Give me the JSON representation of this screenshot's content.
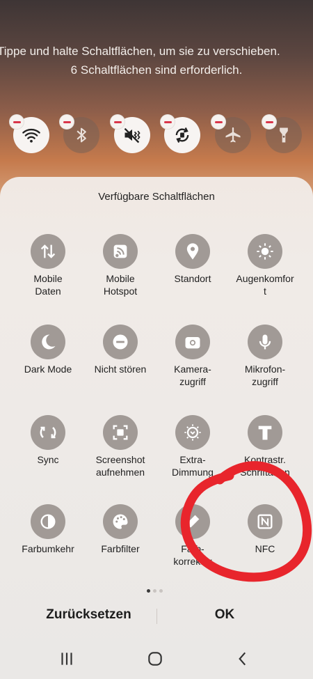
{
  "header": {
    "hint_line1": "Tippe und halte Schaltflächen, um sie zu verschieben.",
    "hint_line2": "6 Schaltflächen sind erforderlich."
  },
  "active_buttons": [
    {
      "name": "wlan",
      "icon": "wifi-icon",
      "state": "on"
    },
    {
      "name": "bluetooth",
      "icon": "bluetooth-icon",
      "state": "off"
    },
    {
      "name": "ton",
      "icon": "sound-vibrate-icon",
      "state": "on"
    },
    {
      "name": "auto-drehen",
      "icon": "auto-rotate-icon",
      "state": "on"
    },
    {
      "name": "flugmodus",
      "icon": "airplane-icon",
      "state": "off"
    },
    {
      "name": "taschenlampe",
      "icon": "flashlight-icon",
      "state": "off"
    }
  ],
  "panel": {
    "title": "Verfügbare Schaltflächen",
    "tiles": [
      {
        "label": "Mobile\nDaten",
        "icon": "mobile-data-icon"
      },
      {
        "label": "Mobile\nHotspot",
        "icon": "hotspot-icon"
      },
      {
        "label": "Standort",
        "icon": "location-icon"
      },
      {
        "label": "Augenkomfor\nt",
        "icon": "eye-comfort-icon"
      },
      {
        "label": "Dark Mode",
        "icon": "dark-mode-icon"
      },
      {
        "label": "Nicht stören",
        "icon": "do-not-disturb-icon"
      },
      {
        "label": "Kamera-\nzugriff",
        "icon": "camera-icon"
      },
      {
        "label": "Mikrofon-\nzugriff",
        "icon": "microphone-icon"
      },
      {
        "label": "Sync",
        "icon": "sync-icon"
      },
      {
        "label": "Screenshot\naufnehmen",
        "icon": "screenshot-icon"
      },
      {
        "label": "Extra-\nDimmung",
        "icon": "extra-dim-icon"
      },
      {
        "label": "Kontrastr.\nSchriftarten",
        "icon": "contrast-font-icon"
      },
      {
        "label": "Farbumkehr",
        "icon": "color-inversion-icon"
      },
      {
        "label": "Farbfilter",
        "icon": "palette-icon"
      },
      {
        "label": "Farb-\nkorrektur",
        "icon": "color-correction-icon"
      },
      {
        "label": "NFC",
        "icon": "nfc-icon"
      }
    ],
    "page_indicator": {
      "pages": 3,
      "current": 1
    },
    "reset_label": "Zurücksetzen",
    "ok_label": "OK"
  },
  "navbar": {
    "recents": "recents-icon",
    "home": "home-icon",
    "back": "back-icon"
  },
  "colors": {
    "tile": "#a19a96",
    "annotation": "#e8252c",
    "minus": "#d9364a"
  }
}
